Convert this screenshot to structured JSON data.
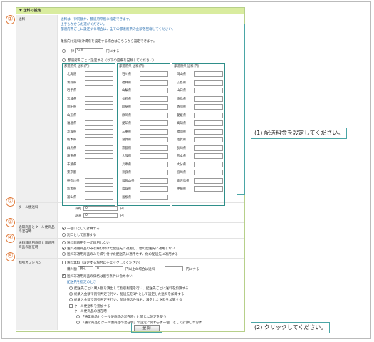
{
  "section_title": "▼ 送料の設定",
  "labels": {
    "shipping": "送料",
    "cool": "クール便送料",
    "normal_cool": "通常商品とクール便商品の混在時",
    "shipping_normal": "送料非適用商品と非適用商品の混在時",
    "discount": "割引オプション"
  },
  "numbers": [
    "①",
    "②",
    "③",
    "④",
    "⑤"
  ],
  "notes": {
    "line1": "送料は一律同額か、都道府県別に指定できます。",
    "line2": "上手もかからお選びください。",
    "line3": "都道府県ごとに設定する場合は、全ての都道府県の金額を記載してください。"
  },
  "overseas_text": "離島向け送料(沖縄県を設定する場合はこちらから設定できます。",
  "overseas_link": "こちら",
  "flat": {
    "label": "一律",
    "value": "540",
    "suffix": "円にする"
  },
  "per_pref_label": "都道府県ごとに設定する（以下の空欄を記載してください）",
  "pref_header": {
    "col1": "都道府県",
    "col2": "送料(円)"
  },
  "prefectures": [
    [
      "北海道",
      "青森県",
      "岩手県",
      "宮城県",
      "秋田県",
      "山形県",
      "福島県",
      "茨城県",
      "栃木県",
      "群馬県",
      "埼玉県",
      "千葉県",
      "東京都",
      "神奈川県",
      "新潟県",
      "富山県"
    ],
    [
      "石川県",
      "福井県",
      "山梨県",
      "長野県",
      "岐阜県",
      "静岡県",
      "愛知県",
      "三重県",
      "滋賀県",
      "京都府",
      "大阪府",
      "兵庫県",
      "奈良県",
      "和歌山県",
      "鳥取県",
      "島根県"
    ],
    [
      "岡山県",
      "広島県",
      "山口県",
      "徳島県",
      "香川県",
      "愛媛県",
      "高知県",
      "福岡県",
      "佐賀県",
      "長崎県",
      "熊本県",
      "大分県",
      "宮崎県",
      "鹿児島県",
      "沖縄県"
    ]
  ],
  "cool": {
    "normal_label": "冷蔵",
    "normal_value": "0",
    "frozen_label": "冷凍",
    "frozen_value": "0",
    "unit": "円"
  },
  "normal_cool_options": [
    "一個口として計算する",
    "別口として計算する"
  ],
  "shipping_normal_options": [
    "送料非適用を一切適用しない",
    "送料適用商品のみを繰り付けた配送先に適用し、他の配送先に適用しない",
    "送料非適用商品のみを繰り付けた配送先に適用せず、他の配送先に適用する"
  ],
  "discount": {
    "free_label": "送料無料（設定する場合はチェックしてください）",
    "buy_label": "購入額",
    "buy_select": "税込",
    "buy_value": "0",
    "buy_suffix": "円以上の場合は送料",
    "buy_suffix2": "円にする",
    "exclude_label": "送料非適用商品の価格は割引条件に含めない",
    "link": "配送先を指定のとき",
    "options": [
      "配送先ごとに購入額を算出して割引判定を行い、配送先ごとに送料を加算する",
      "総購入金額で割引判定を行い、配送先を1件として設定した送料を加算する",
      "総購入金額で割引判定を行い、配送先の件数分、設定した送料を加算する"
    ],
    "cool_add_label": "クール便送料を追加する",
    "cool_note": "クール便商品の混在時",
    "cool_options": [
      "「通常商品とクール便商品の混在時」と同じに設定を使う",
      "「通常商品とクール便商品の混在時」の設定に関わらず一個口として計算しなおす"
    ]
  },
  "submit_label": "登 録",
  "callouts": {
    "one": "(1) 配送料金を設定してください。",
    "two": "(2) クリックしてください。"
  },
  "colors": {
    "accent": "#e07a3a",
    "callout": "#4aa6a6",
    "header": "#d9ec9f"
  }
}
